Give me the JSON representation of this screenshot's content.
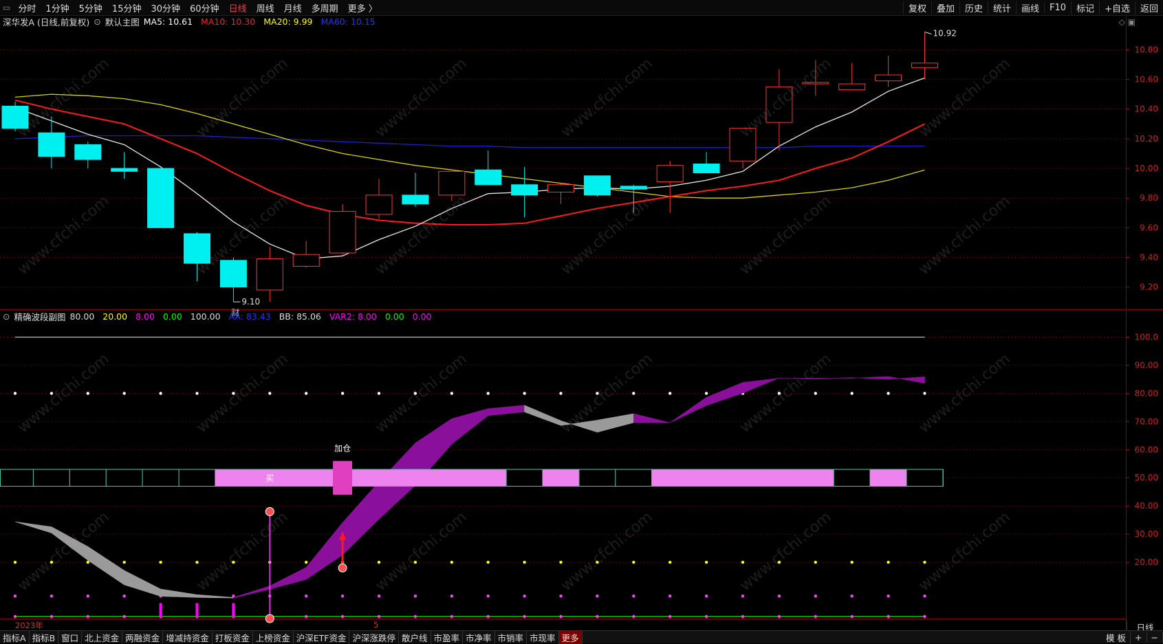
{
  "toolbar": {
    "periods": [
      "分时",
      "1分钟",
      "5分钟",
      "15分钟",
      "30分钟",
      "60分钟",
      "日线",
      "周线",
      "月线",
      "多周期",
      "更多 〉"
    ],
    "active_period": "日线",
    "right_items": [
      "复权",
      "叠加",
      "历史",
      "统计",
      "画线",
      "F10",
      "标记",
      "+自选",
      "返回"
    ]
  },
  "main_pane": {
    "stock": "深华发A (日线,前复权)",
    "template": "默认主图",
    "ma": [
      {
        "label": "MA5: 10.61",
        "color": "#ffffff"
      },
      {
        "label": "MA10: 10.30",
        "color": "#ff2020"
      },
      {
        "label": "MA20: 9.99",
        "color": "#ffff00"
      },
      {
        "label": "MA60: 10.15",
        "color": "#2233ff"
      }
    ],
    "y_ticks": [
      "10.80",
      "10.60",
      "10.40",
      "10.20",
      "10.00",
      "9.80",
      "9.60",
      "9.40",
      "9.20"
    ],
    "high_label": "10.92",
    "low_label": "9.10",
    "event_marker": "财"
  },
  "sub_pane": {
    "name": "精确波段副图",
    "values": [
      {
        "label": "80.00",
        "color": "#dddddd"
      },
      {
        "label": "20.00",
        "color": "#ffff00"
      },
      {
        "label": "8.00",
        "color": "#ff00ff"
      },
      {
        "label": "0.00",
        "color": "#00ff00"
      },
      {
        "label": "100.00",
        "color": "#dddddd"
      },
      {
        "label": "AA: 83.43",
        "color": "#2233ff"
      },
      {
        "label": "BB: 85.06",
        "color": "#dddddd"
      },
      {
        "label": "VAR2: 8.00",
        "color": "#ff00ff"
      },
      {
        "label": "0.00",
        "color": "#00ff00"
      },
      {
        "label": "0.00",
        "color": "#ff00ff"
      }
    ],
    "y_ticks": [
      "100.0",
      "90.00",
      "80.00",
      "70.00",
      "60.00",
      "50.00",
      "40.00",
      "30.00",
      "20.00"
    ],
    "buy_label": "买",
    "add_label": "加仓"
  },
  "axis": {
    "year": "2023年",
    "month": "5"
  },
  "period_tag": "日线",
  "bottom_tabs": [
    "指标A",
    "指标B",
    "窗口",
    "北上资金",
    "两融资金",
    "增减持资金",
    "打板资金",
    "上榜资金",
    "沪深ETF资金",
    "沪深涨跌停",
    "散户线",
    "市盈率",
    "市净率",
    "市销率",
    "市现率",
    "更多"
  ],
  "bottom_active": "更多",
  "bottom_right": [
    "模 板",
    "+",
    "−"
  ],
  "watermark": "www.cfchi.com",
  "chart_data": {
    "type": "candlestick",
    "ylim": [
      9.05,
      10.95
    ],
    "candles": [
      {
        "o": 10.42,
        "h": 10.45,
        "l": 10.25,
        "c": 10.27
      },
      {
        "o": 10.24,
        "h": 10.35,
        "l": 10.0,
        "c": 10.08
      },
      {
        "o": 10.16,
        "h": 10.18,
        "l": 10.0,
        "c": 10.06
      },
      {
        "o": 10.0,
        "h": 10.11,
        "l": 9.93,
        "c": 9.98
      },
      {
        "o": 10.0,
        "h": 10.0,
        "l": 9.6,
        "c": 9.6
      },
      {
        "o": 9.56,
        "h": 9.57,
        "l": 9.24,
        "c": 9.36
      },
      {
        "o": 9.38,
        "h": 9.4,
        "l": 9.1,
        "c": 9.2
      },
      {
        "o": 9.18,
        "h": 9.47,
        "l": 9.1,
        "c": 9.39
      },
      {
        "o": 9.34,
        "h": 9.51,
        "l": 9.33,
        "c": 9.42
      },
      {
        "o": 9.43,
        "h": 9.76,
        "l": 9.42,
        "c": 9.71
      },
      {
        "o": 9.69,
        "h": 9.93,
        "l": 9.66,
        "c": 9.82
      },
      {
        "o": 9.82,
        "h": 9.97,
        "l": 9.74,
        "c": 9.76
      },
      {
        "o": 9.82,
        "h": 9.98,
        "l": 9.78,
        "c": 9.98
      },
      {
        "o": 9.99,
        "h": 10.12,
        "l": 9.89,
        "c": 9.89
      },
      {
        "o": 9.89,
        "h": 10.01,
        "l": 9.67,
        "c": 9.82
      },
      {
        "o": 9.84,
        "h": 9.9,
        "l": 9.76,
        "c": 9.89
      },
      {
        "o": 9.95,
        "h": 9.95,
        "l": 9.81,
        "c": 9.82
      },
      {
        "o": 9.88,
        "h": 9.89,
        "l": 9.7,
        "c": 9.86
      },
      {
        "o": 9.91,
        "h": 10.05,
        "l": 9.7,
        "c": 10.02
      },
      {
        "o": 10.03,
        "h": 10.11,
        "l": 9.97,
        "c": 9.97
      },
      {
        "o": 10.05,
        "h": 10.27,
        "l": 10.0,
        "c": 10.27
      },
      {
        "o": 10.31,
        "h": 10.67,
        "l": 10.12,
        "c": 10.55
      },
      {
        "o": 10.57,
        "h": 10.73,
        "l": 10.49,
        "c": 10.58
      },
      {
        "o": 10.53,
        "h": 10.71,
        "l": 10.53,
        "c": 10.57
      },
      {
        "o": 10.59,
        "h": 10.76,
        "l": 10.55,
        "c": 10.63
      },
      {
        "o": 10.68,
        "h": 10.92,
        "l": 10.6,
        "c": 10.71
      }
    ],
    "ma5": [
      10.41,
      10.32,
      10.23,
      10.16,
      10.01,
      9.83,
      9.64,
      9.49,
      9.39,
      9.41,
      9.52,
      9.61,
      9.73,
      9.83,
      9.84,
      9.86,
      9.87,
      9.86,
      9.88,
      9.92,
      9.98,
      10.15,
      10.28,
      10.38,
      10.52,
      10.61
    ],
    "ma10": [
      10.46,
      10.4,
      10.35,
      10.3,
      10.2,
      10.1,
      9.97,
      9.85,
      9.75,
      9.69,
      9.65,
      9.63,
      9.62,
      9.62,
      9.63,
      9.68,
      9.73,
      9.77,
      9.81,
      9.85,
      9.88,
      9.92,
      10.0,
      10.07,
      10.18,
      10.3
    ],
    "ma20": [
      10.48,
      10.5,
      10.49,
      10.47,
      10.43,
      10.37,
      10.3,
      10.23,
      10.16,
      10.1,
      10.06,
      10.02,
      9.99,
      9.96,
      9.93,
      9.9,
      9.87,
      9.84,
      9.81,
      9.8,
      9.8,
      9.82,
      9.84,
      9.87,
      9.92,
      9.99
    ],
    "ma60": [
      10.2,
      10.21,
      10.22,
      10.22,
      10.22,
      10.22,
      10.21,
      10.2,
      10.19,
      10.18,
      10.17,
      10.16,
      10.15,
      10.15,
      10.14,
      10.14,
      10.14,
      10.14,
      10.14,
      10.14,
      10.14,
      10.14,
      10.15,
      10.15,
      10.15,
      10.15
    ],
    "sub_ylim": [
      0,
      105
    ],
    "sub_upper": [
      34.4,
      32.6,
      25.6,
      17.1,
      10.5,
      8.5,
      7.5,
      11.6,
      18.2,
      34.1,
      48.6,
      62.4,
      71.0,
      74.6,
      75.8,
      70.3,
      66.2,
      69.6,
      69.6,
      78.6,
      83.9,
      85.4,
      85.4,
      85.4,
      86.0,
      83.6
    ],
    "sub_lower": [
      34.4,
      30.4,
      20.7,
      12.0,
      7.9,
      7.5,
      7.3,
      10.4,
      13.9,
      22.6,
      35.3,
      47.3,
      62.0,
      72.1,
      73.4,
      68.6,
      70.5,
      72.8,
      69.6,
      75.7,
      80.1,
      85.5,
      85.2,
      85.6,
      85.0,
      85.9
    ],
    "sub_fill": [
      "gray",
      "gray",
      "gray",
      "gray",
      "gray",
      "gray",
      "purple",
      "purple",
      "purple",
      "purple",
      "purple",
      "purple",
      "purple",
      "purple",
      "gray",
      "gray",
      "gray",
      "purple",
      "purple",
      "purple",
      "purple",
      "purple",
      "purple",
      "purple",
      "purple",
      "gray"
    ],
    "strip": [
      0,
      0,
      0,
      0,
      0,
      0,
      1,
      1,
      1,
      1,
      1,
      1,
      1,
      1,
      0,
      1,
      0,
      0,
      1,
      1,
      1,
      1,
      1,
      0,
      1,
      0
    ],
    "magenta_spikes": [
      4,
      5,
      6
    ],
    "add_index": 9,
    "buy_index": 7,
    "red_arrow_index": 9
  }
}
